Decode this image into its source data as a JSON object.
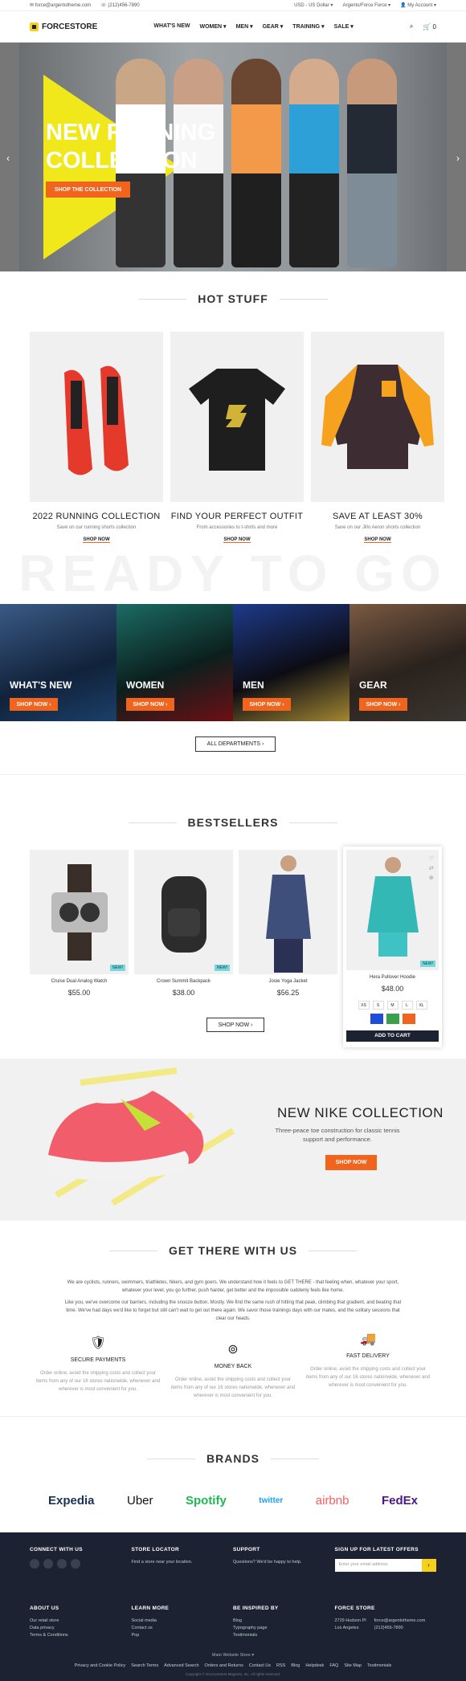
{
  "topbar": {
    "email": "force@argentotheme.com",
    "phone": "(212)456-7890",
    "currency": "USD - US Dollar",
    "store": "Argento/Force Force",
    "account": "My Account"
  },
  "header": {
    "logo": "FORCESTORE",
    "nav": [
      "WHAT'S NEW",
      "WOMEN",
      "MEN",
      "GEAR",
      "TRAINING",
      "SALE"
    ],
    "cart_count": "0"
  },
  "hero": {
    "title": "NEW RUNNING COLLECTION",
    "button": "SHOP THE COLLECTION"
  },
  "hot": {
    "title": "HOT STUFF",
    "cards": [
      {
        "title": "2022 RUNNING COLLECTION",
        "sub": "Save on our running shorts collection",
        "link": "SHOP NOW"
      },
      {
        "title": "FIND YOUR PERFECT OUTFIT",
        "sub": "From accessories to t-shirts and more",
        "link": "SHOP NOW"
      },
      {
        "title": "SAVE AT LEAST 30%",
        "sub": "Save on our Jillo Aeron shorts collection",
        "link": "SHOP NOW"
      }
    ]
  },
  "watermark": "READY TO GO",
  "categories": [
    {
      "label": "WHAT'S NEW",
      "button": "SHOP NOW"
    },
    {
      "label": "WOMEN",
      "button": "SHOP NOW"
    },
    {
      "label": "MEN",
      "button": "SHOP NOW"
    },
    {
      "label": "GEAR",
      "button": "SHOP NOW"
    }
  ],
  "all_departments": "ALL DEPARTMENTS",
  "bestsellers": {
    "title": "BESTSELLERS",
    "products": [
      {
        "name": "Cruise Dual Analog Watch",
        "price": "$55.00",
        "badge": "NEW!"
      },
      {
        "name": "Crown Summit Backpack",
        "price": "$38.00",
        "badge": "NEW!"
      },
      {
        "name": "Josie Yoga Jacket",
        "price": "$56.25",
        "badge": ""
      },
      {
        "name": "Hera Pullover Hoodie",
        "price": "$48.00",
        "badge": "NEW!"
      }
    ],
    "sizes": [
      "XS",
      "S",
      "M",
      "L",
      "XL"
    ],
    "swatches": [
      "#1d4fd6",
      "#3aa14a",
      "#f0641e"
    ],
    "add_to_cart": "ADD TO CART",
    "shop_now": "SHOP NOW"
  },
  "nike": {
    "title": "NEW NIKE COLLECTION",
    "desc": "Three-peace toe construction for classic tennis support and performance.",
    "button": "SHOP NOW"
  },
  "about": {
    "title": "GET THERE WITH US",
    "p1": "We are cyclists, runners, swimmers, triathletes, hikers, and gym goers. We understand how it feels to GET THERE - that feeling when, whatever your sport, whatever your level, you go further, push harder, get better and the impossible suddenly feels like home.",
    "p2": "Like you, we've overcome our barriers, including the snooze button. Mostly. We find the same rush of hitting that peak, climbing that gradient, and beating that time. We've had days we'd like to forget but still can't wait to get out there again. We savor those trainings days with our mates, and the solitary sessions that clear our heads.",
    "features": [
      {
        "title": "SECURE PAYMENTS",
        "text": "Order online, avoid the shipping costs and collect your items from any of our 16 stores nationwide, whenever and wherever is most convenient for you."
      },
      {
        "title": "MONEY BACK",
        "text": "Order online, avoid the shipping costs and collect your items from any of our 16 stores nationwide, whenever and wherever is most convenient for you."
      },
      {
        "title": "FAST DELIVERY",
        "text": "Order online, avoid the shipping costs and collect your items from any of our 16 stores nationwide, whenever and wherever is most convenient for you."
      }
    ]
  },
  "brands": {
    "title": "BRANDS",
    "list": [
      "Expedia",
      "Uber",
      "Spotify",
      "twitter",
      "airbnb",
      "FedEx"
    ]
  },
  "footer": {
    "connect": "CONNECT WITH US",
    "locator": {
      "title": "STORE LOCATOR",
      "text": "Find a store near your location."
    },
    "support": {
      "title": "SUPPORT",
      "text": "Questions? We'd be happy to help."
    },
    "signup": {
      "title": "SIGN UP FOR LATEST OFFERS",
      "placeholder": "Enter your email address"
    },
    "about": {
      "title": "ABOUT US",
      "items": [
        "Our retail store",
        "Data privacy",
        "Terms & Conditions"
      ]
    },
    "learn": {
      "title": "LEARN MORE",
      "items": [
        "Social media",
        "Contact us",
        "Pop"
      ]
    },
    "inspired": {
      "title": "BE INSPIRED BY",
      "items": [
        "Blog",
        "Typography page",
        "Testimonials"
      ]
    },
    "force": {
      "title": "FORCE STORE",
      "addr1": "2729 Hudson Pl",
      "addr2": "Los Angeles",
      "email": "force@argentotheme.com",
      "phone": "(212)456-7890"
    },
    "website_store": "Main Website Store",
    "links": [
      "Privacy and Cookie Policy",
      "Search Terms",
      "Advanced Search",
      "Orders and Returns",
      "Contact Us",
      "RSS",
      "Blog",
      "Helpdesk",
      "FAQ",
      "Site Map",
      "Testimonials"
    ],
    "copyright": "Copyright © 2013-present Magento, Inc. All rights reserved."
  }
}
